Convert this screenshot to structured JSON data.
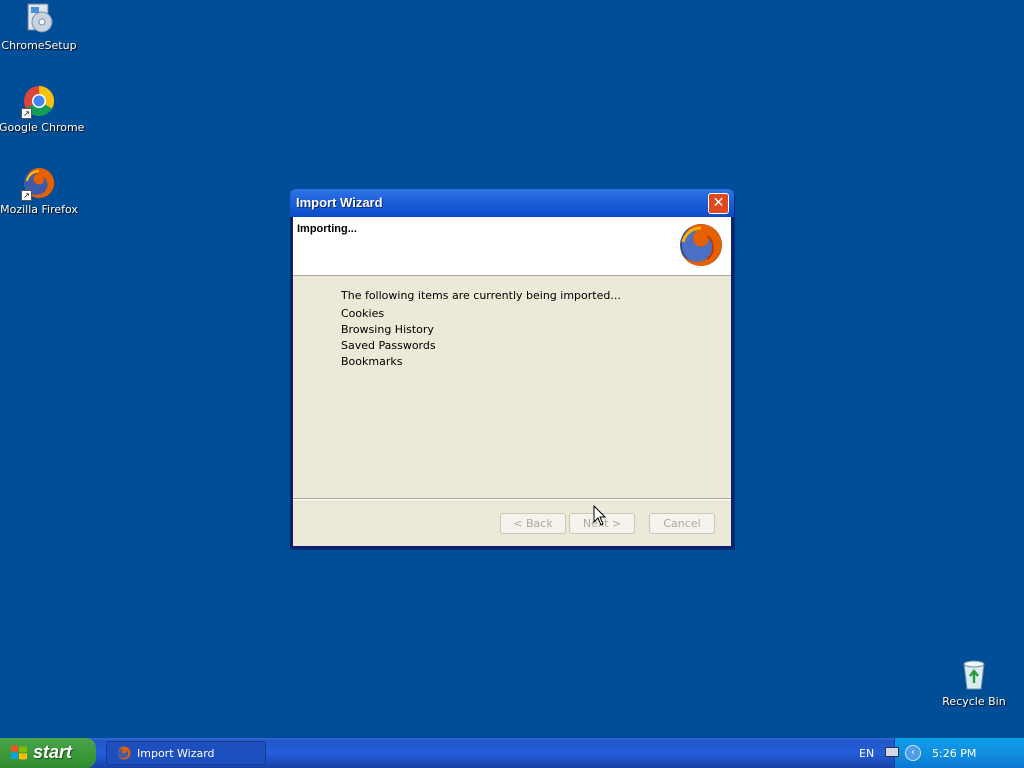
{
  "desktop": {
    "icons": [
      {
        "label": "ChromeSetup",
        "icon": "installer-icon"
      },
      {
        "label": "Google Chrome",
        "icon": "chrome-icon"
      },
      {
        "label": "Mozilla Firefox",
        "icon": "firefox-icon"
      },
      {
        "label": "Recycle Bin",
        "icon": "recycle-bin-icon"
      }
    ]
  },
  "dialog": {
    "title": "Import Wizard",
    "header": "Importing...",
    "intro": "The following items are currently being imported...",
    "items": [
      "Cookies",
      "Browsing History",
      "Saved Passwords",
      "Bookmarks"
    ],
    "buttons": {
      "back": "< Back",
      "next": "Next >",
      "cancel": "Cancel"
    },
    "close_glyph": "✕"
  },
  "taskbar": {
    "start_label": "start",
    "task_item": "Import Wizard",
    "language": "EN",
    "clock": "5:26 PM"
  },
  "colors": {
    "desktop_bg": "#004e98",
    "titlebar": "#1d5fd8",
    "dialog_bg": "#ece9d8",
    "start_green": "#3c9a3c"
  }
}
